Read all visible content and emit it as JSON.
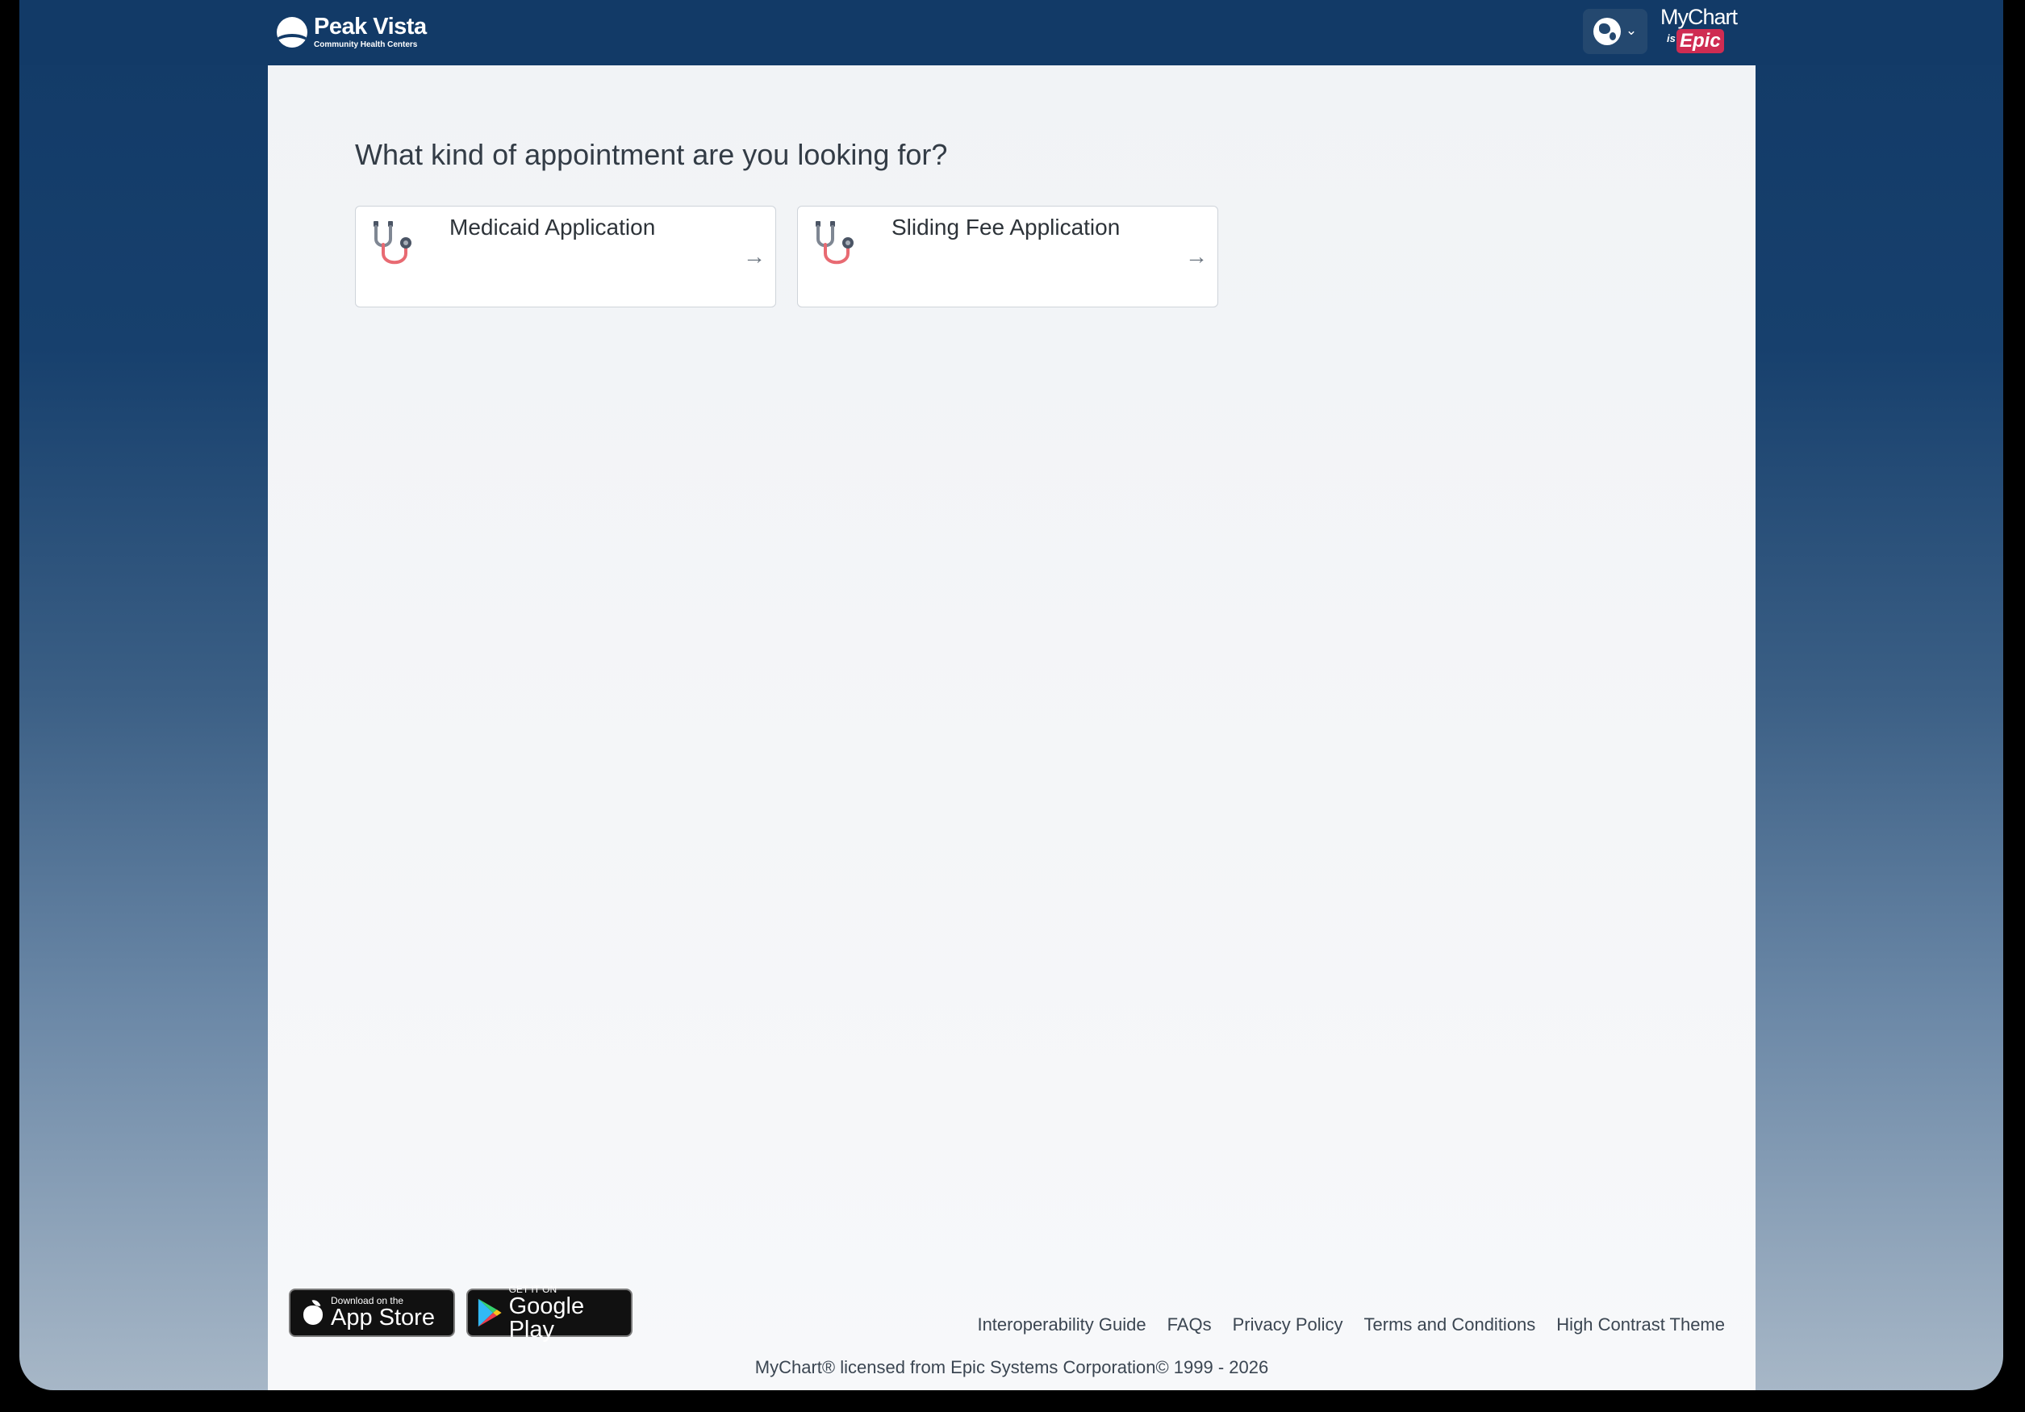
{
  "header": {
    "org_name": "Peak Vista",
    "org_subtitle": "Community Health Centers",
    "language_button_icon": "globe-icon",
    "brand_mychart": "MyChart",
    "brand_is": "is",
    "brand_epic": "Epic"
  },
  "main": {
    "question": "What kind of appointment are you looking for?",
    "cards": [
      {
        "label": "Medicaid Application",
        "icon": "stethoscope-icon",
        "arrow": "→"
      },
      {
        "label": "Sliding Fee Application",
        "icon": "stethoscope-icon",
        "arrow": "→"
      }
    ]
  },
  "footer": {
    "app_store": {
      "top": "Download on the",
      "main": "App Store"
    },
    "google_play": {
      "top": "GET IT ON",
      "main": "Google Play"
    },
    "links": [
      "Interoperability Guide",
      "FAQs",
      "Privacy Policy",
      "Terms and Conditions",
      "High Contrast Theme"
    ],
    "copyright": "MyChart® licensed from Epic Systems Corporation© 1999 - 2026"
  },
  "colors": {
    "header_bg": "#123a67",
    "content_bg": "#f1f3f6",
    "epic_red": "#cf2c52",
    "stethoscope_pink": "#e86a72"
  }
}
